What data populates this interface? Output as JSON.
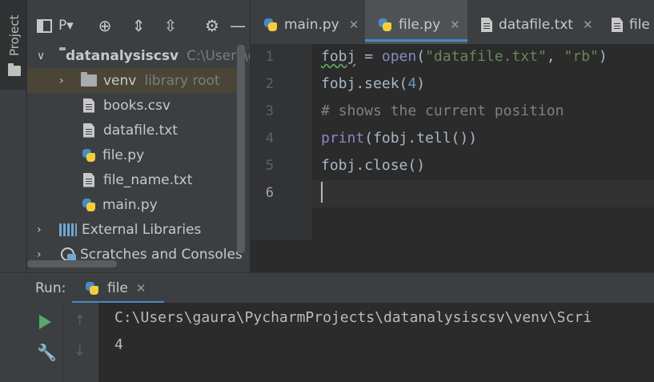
{
  "sidebar": {
    "tab_label": "Project"
  },
  "project_toolbar": {
    "view_label": "P▾"
  },
  "tree": {
    "items": [
      {
        "label": "datanalysiscsv",
        "hint": "C:\\Users\\g"
      },
      {
        "label": "venv",
        "hint": "library root"
      },
      {
        "label": "books.csv"
      },
      {
        "label": "datafile.txt"
      },
      {
        "label": "file.py"
      },
      {
        "label": "file_name.txt"
      },
      {
        "label": "main.py"
      },
      {
        "label": "External Libraries"
      },
      {
        "label": "Scratches and Consoles"
      }
    ]
  },
  "tabs": [
    {
      "label": "main.py",
      "close": "✕"
    },
    {
      "label": "file.py",
      "close": "✕"
    },
    {
      "label": "datafile.txt",
      "close": "✕"
    },
    {
      "label": "file"
    }
  ],
  "editor": {
    "line_numbers": [
      "1",
      "2",
      "3",
      "4",
      "5",
      "6"
    ],
    "lines": [
      {
        "a": "fobj",
        "b": " = ",
        "c": "open",
        "d": "(",
        "e": "\"datafile.txt\"",
        "f": ", ",
        "g": "\"rb\"",
        "h": ")"
      },
      {
        "a": "fobj.seek(",
        "b": "4",
        "c": ")"
      },
      {
        "a": "# shows the current position"
      },
      {
        "a": "print",
        "b": "(fobj.tell())"
      },
      {
        "a": "fobj.close()"
      }
    ]
  },
  "run": {
    "label": "Run:",
    "tab_label": "file",
    "tab_close": "✕",
    "output": [
      "C:\\Users\\gaura\\PycharmProjects\\datanalysiscsv\\venv\\Scri",
      "4"
    ]
  }
}
